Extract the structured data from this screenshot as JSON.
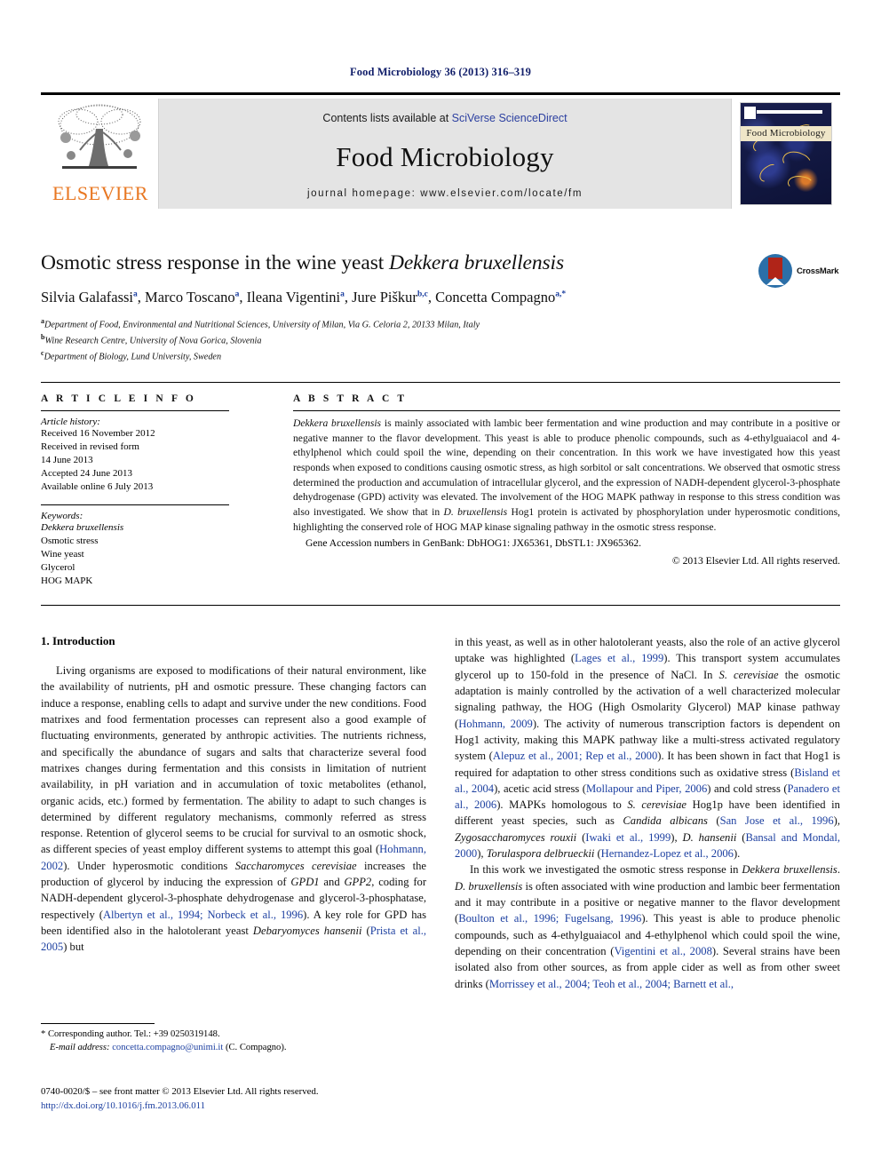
{
  "running_head": "Food Microbiology 36 (2013) 316–319",
  "masthead": {
    "publisher_name": "ELSEVIER",
    "contents_prefix": "Contents lists available at ",
    "contents_link": "SciVerse ScienceDirect",
    "journal_name": "Food Microbiology",
    "homepage": "journal homepage: www.elsevier.com/locate/fm",
    "cover_title": "Food Microbiology"
  },
  "title": {
    "main": "Osmotic stress response in the wine yeast ",
    "species": "Dekkera bruxellensis",
    "crossmark_label": "CrossMark"
  },
  "authors": [
    {
      "name": "Silvia Galafassi",
      "sup": "a",
      "sep": ", "
    },
    {
      "name": "Marco Toscano",
      "sup": "a",
      "sep": ", "
    },
    {
      "name": "Ileana Vigentini",
      "sup": "a",
      "sep": ", "
    },
    {
      "name": "Jure Piškur",
      "sup": "b,c",
      "sep": ", "
    },
    {
      "name": "Concetta Compagno",
      "sup": "a,*",
      "sep": ""
    }
  ],
  "affiliations": [
    {
      "sup": "a",
      "text": "Department of Food, Environmental and Nutritional Sciences, University of Milan, Via G. Celoria 2, 20133 Milan, Italy"
    },
    {
      "sup": "b",
      "text": "Wine Research Centre, University of Nova Gorica, Slovenia"
    },
    {
      "sup": "c",
      "text": "Department of Biology, Lund University, Sweden"
    }
  ],
  "article_info": {
    "heading": "A R T I C L E  I N F O",
    "history_label": "Article history:",
    "history": [
      "Received 16 November 2012",
      "Received in revised form",
      "14 June 2013",
      "Accepted 24 June 2013",
      "Available online 6 July 2013"
    ],
    "keywords_label": "Keywords:",
    "keywords": [
      "Dekkera bruxellensis",
      "Osmotic stress",
      "Wine yeast",
      "Glycerol",
      "HOG MAPK"
    ]
  },
  "abstract": {
    "heading": "A B S T R A C T",
    "species_lead": "Dekkera bruxellensis",
    "body": " is mainly associated with lambic beer fermentation and wine production and may contribute in a positive or negative manner to the flavor development. This yeast is able to produce phenolic compounds, such as 4-ethylguaiacol and 4-ethylphenol which could spoil the wine, depending on their concentration. In this work we have investigated how this yeast responds when exposed to conditions causing osmotic stress, as high sorbitol or salt concentrations. We observed that osmotic stress determined the production and accumulation of intracellular glycerol, and the expression of NADH-dependent glycerol-3-phosphate dehydrogenase (GPD) activity was elevated. The involvement of the HOG MAPK pathway in response to this stress condition was also investigated. We show that in ",
    "species_mid": "D. bruxellensis",
    "body_tail": " Hog1 protein is activated by phosphorylation under hyperosmotic conditions, highlighting the conserved role of HOG MAP kinase signaling pathway in the osmotic stress response.",
    "accession_prefix": "Gene Accession numbers in GenBank: ",
    "accession_gene1": "DbHOG1",
    "accession_num1": ": JX65361, ",
    "accession_gene2": "DbSTL1",
    "accession_num2": ": JX965362.",
    "copyright": "© 2013 Elsevier Ltd. All rights reserved."
  },
  "body": {
    "section_title": "1. Introduction",
    "left_paragraphs": [
      {
        "segments": [
          {
            "t": "Living organisms are exposed to modifications of their natural environment, like the availability of nutrients, pH and osmotic pressure. These changing factors can induce a response, enabling cells to adapt and survive under the new conditions. Food matrixes and food fermentation processes can represent also a good example of fluctuating environments, generated by anthropic activities. The nutrients richness, and specifically the abundance of sugars and salts that characterize several food matrixes changes during fermentation and this consists in limitation of nutrient availability, in pH variation and in accumulation of toxic metabolites (ethanol, organic acids, etc.) formed by fermentation. The ability to adapt to such changes is determined by different regulatory mechanisms, commonly referred as stress response. Retention of glycerol seems to be crucial for survival to an osmotic shock, as different species of yeast employ different systems to attempt this goal (",
            "k": "plain"
          },
          {
            "t": "Hohmann, 2002",
            "k": "ref"
          },
          {
            "t": "). Under hyperosmotic conditions ",
            "k": "plain"
          },
          {
            "t": "Saccharomyces cerevisiae",
            "k": "it"
          },
          {
            "t": " increases the production of glycerol by inducing the expression of ",
            "k": "plain"
          },
          {
            "t": "GPD1",
            "k": "it"
          },
          {
            "t": " and ",
            "k": "plain"
          },
          {
            "t": "GPP2",
            "k": "it"
          },
          {
            "t": ", coding for NADH-dependent glycerol-3-phosphate dehydrogenase and glycerol-3-phosphatase, respectively (",
            "k": "plain"
          },
          {
            "t": "Albertyn et al., 1994; Norbeck et al., 1996",
            "k": "ref"
          },
          {
            "t": "). A key role for GPD has been identified also in the halotolerant yeast ",
            "k": "plain"
          },
          {
            "t": "Debaryomyces hansenii",
            "k": "it"
          },
          {
            "t": " (",
            "k": "plain"
          },
          {
            "t": "Prista et al., 2005",
            "k": "ref"
          },
          {
            "t": ") but",
            "k": "plain"
          }
        ]
      }
    ],
    "right_paragraphs": [
      {
        "indent": false,
        "segments": [
          {
            "t": "in this yeast, as well as in other halotolerant yeasts, also the role of an active glycerol uptake was highlighted (",
            "k": "plain"
          },
          {
            "t": "Lages et al., 1999",
            "k": "ref"
          },
          {
            "t": "). This transport system accumulates glycerol up to 150-fold in the presence of NaCl. In ",
            "k": "plain"
          },
          {
            "t": "S. cerevisiae",
            "k": "it"
          },
          {
            "t": " the osmotic adaptation is mainly controlled by the activation of a well characterized molecular signaling pathway, the HOG (High Osmolarity Glycerol) MAP kinase pathway (",
            "k": "plain"
          },
          {
            "t": "Hohmann, 2009",
            "k": "ref"
          },
          {
            "t": "). The activity of numerous transcription factors is dependent on Hog1 activity, making this MAPK pathway like a multi-stress activated regulatory system (",
            "k": "plain"
          },
          {
            "t": "Alepuz et al., 2001; Rep et al., 2000",
            "k": "ref"
          },
          {
            "t": "). It has been shown in fact that Hog1 is required for adaptation to other stress conditions such as oxidative stress (",
            "k": "plain"
          },
          {
            "t": "Bisland et al., 2004",
            "k": "ref"
          },
          {
            "t": "), acetic acid stress (",
            "k": "plain"
          },
          {
            "t": "Mollapour and Piper, 2006",
            "k": "ref"
          },
          {
            "t": ") and cold stress (",
            "k": "plain"
          },
          {
            "t": "Panadero et al., 2006",
            "k": "ref"
          },
          {
            "t": "). MAPKs homologous to ",
            "k": "plain"
          },
          {
            "t": "S. cerevisiae",
            "k": "it"
          },
          {
            "t": " Hog1p have been identified in different yeast species, such as ",
            "k": "plain"
          },
          {
            "t": "Candida albicans",
            "k": "it"
          },
          {
            "t": " (",
            "k": "plain"
          },
          {
            "t": "San Jose et al., 1996",
            "k": "ref"
          },
          {
            "t": "), ",
            "k": "plain"
          },
          {
            "t": "Zygosaccharomyces rouxii",
            "k": "it"
          },
          {
            "t": " (",
            "k": "plain"
          },
          {
            "t": "Iwaki et al., 1999",
            "k": "ref"
          },
          {
            "t": "), ",
            "k": "plain"
          },
          {
            "t": "D. hansenii",
            "k": "it"
          },
          {
            "t": " (",
            "k": "plain"
          },
          {
            "t": "Bansal and Mondal, 2000",
            "k": "ref"
          },
          {
            "t": "), ",
            "k": "plain"
          },
          {
            "t": "Torulaspora delbrueckii",
            "k": "it"
          },
          {
            "t": " (",
            "k": "plain"
          },
          {
            "t": "Hernandez-Lopez et al., 2006",
            "k": "ref"
          },
          {
            "t": ").",
            "k": "plain"
          }
        ]
      },
      {
        "indent": true,
        "segments": [
          {
            "t": "In this work we investigated the osmotic stress response in ",
            "k": "plain"
          },
          {
            "t": "Dekkera bruxellensis",
            "k": "it"
          },
          {
            "t": ". ",
            "k": "plain"
          },
          {
            "t": "D. bruxellensis",
            "k": "it"
          },
          {
            "t": " is often associated with wine production and lambic beer fermentation and it may contribute in a positive or negative manner to the flavor development (",
            "k": "plain"
          },
          {
            "t": "Boulton et al., 1996; Fugelsang, 1996",
            "k": "ref"
          },
          {
            "t": "). This yeast is able to produce phenolic compounds, such as 4-ethylguaiacol and 4-ethylphenol which could spoil the wine, depending on their concentration (",
            "k": "plain"
          },
          {
            "t": "Vigentini et al., 2008",
            "k": "ref"
          },
          {
            "t": "). Several strains have been isolated also from other sources, as from apple cider as well as from other sweet drinks (",
            "k": "plain"
          },
          {
            "t": "Morrissey et al., 2004; Teoh et al., 2004; Barnett et al.,",
            "k": "ref"
          }
        ]
      }
    ]
  },
  "footnotes": {
    "corresponding": "* Corresponding author. Tel.: +39 0250319148.",
    "email_label": "E-mail address:",
    "email": " concetta.compagno@unimi.it",
    "email_suffix": " (C. Compagno).",
    "issn_line": "0740-0020/$ – see front matter © 2013 Elsevier Ltd. All rights reserved.",
    "doi": "http://dx.doi.org/10.1016/j.fm.2013.06.011"
  }
}
